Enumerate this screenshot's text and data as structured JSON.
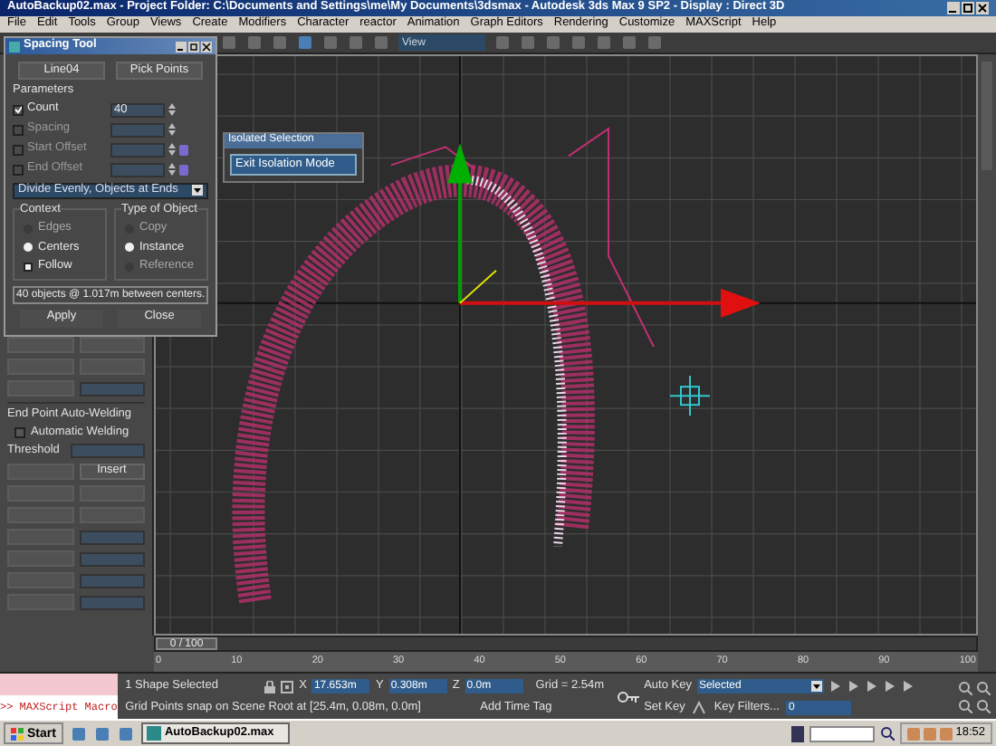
{
  "window": {
    "title": "AutoBackup02.max   - Project Folder: C:\\Documents and Settings\\me\\My Documents\\3dsmax   - Autodesk 3ds Max 9 SP2   - Display : Direct 3D"
  },
  "menu": [
    "File",
    "Edit",
    "Tools",
    "Group",
    "Views",
    "Create",
    "Modifiers",
    "Character",
    "reactor",
    "Animation",
    "Graph Editors",
    "Rendering",
    "Customize",
    "MAXScript",
    "Help"
  ],
  "toolbar": {
    "view_dropdown": "View"
  },
  "spacing_tool": {
    "title": "Spacing Tool",
    "buttons": [
      "Line04",
      "Pick Points"
    ],
    "parameters_label": "Parameters",
    "parameters": [
      {
        "label": "Count",
        "checked": true,
        "value": "40",
        "kind": "plain"
      },
      {
        "label": "Spacing",
        "checked": false,
        "kind": "plain"
      },
      {
        "label": "Start Offset",
        "checked": false,
        "kind": "locked"
      },
      {
        "label": "End Offset",
        "checked": false,
        "kind": "locked"
      }
    ],
    "mode": "Divide Evenly, Objects at Ends",
    "context_label": "Context",
    "context": [
      {
        "label": "Edges",
        "kind": "radio",
        "selected": false
      },
      {
        "label": "Centers",
        "kind": "radio",
        "selected": true
      },
      {
        "label": "Follow",
        "kind": "checkbox",
        "checked": true
      }
    ],
    "type_label": "Type of Object",
    "types": [
      {
        "label": "Copy",
        "selected": false
      },
      {
        "label": "Instance",
        "selected": true
      },
      {
        "label": "Reference",
        "selected": false
      }
    ],
    "info": "40 objects @ 1.017m  between centers.",
    "actions": [
      "Apply",
      "Close"
    ]
  },
  "isolation_dialog": {
    "title": "Isolated Selection",
    "button": "Exit Isolation Mode"
  },
  "command_panel": {
    "group_title": "End Point Auto-Welding",
    "automatic_welding": {
      "label": "Automatic Welding",
      "checked": false
    },
    "threshold_label": "Threshold",
    "insert_button": "Insert"
  },
  "timeline": {
    "position": "0 / 100",
    "level": 0,
    "ticks": [
      "0",
      "10",
      "20",
      "30",
      "40",
      "50",
      "60",
      "70",
      "80",
      "90",
      "100"
    ]
  },
  "status": {
    "maxscript": ">> MAXScript Macro",
    "selection": "1 Shape Selected",
    "coords": [
      {
        "axis": "X",
        "value": "17.653m"
      },
      {
        "axis": "Y",
        "value": "0.308m"
      },
      {
        "axis": "Z",
        "value": "0.0m"
      }
    ],
    "grid": "Grid = 2.54m",
    "prompt": "Grid Points snap on Scene Root at [25.4m, 0.08m, 0.0m]",
    "time_tag": "Add Time Tag",
    "auto_key": "Auto Key",
    "key_mode": "Selected",
    "set_key": "Set Key",
    "key_filters": "Key Filters...",
    "frame": "0"
  },
  "taskbar": {
    "start": "Start",
    "task": "AutoBackup02.max",
    "clock": "18:52"
  }
}
